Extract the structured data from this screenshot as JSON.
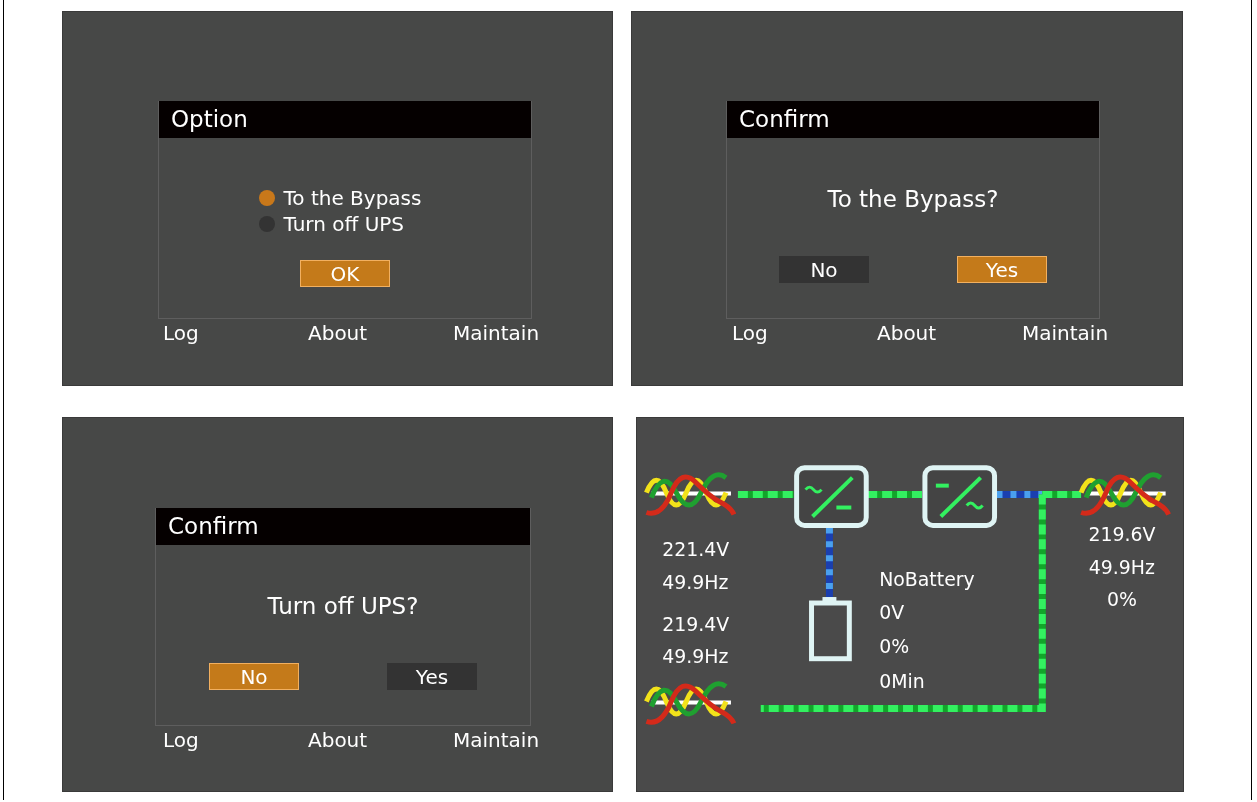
{
  "panels": [
    {
      "kind": "option",
      "dialog": {
        "title": "Option",
        "options": [
          {
            "label": "To the Bypass",
            "selected": true
          },
          {
            "label": "Turn off UPS",
            "selected": false
          }
        ],
        "buttons": [
          {
            "label": "OK",
            "selected": true
          }
        ]
      },
      "menu": [
        "Log",
        "About",
        "Maintain"
      ]
    },
    {
      "kind": "confirm",
      "dialog": {
        "title": "Confirm",
        "message": "To the Bypass?",
        "buttons": [
          {
            "label": "No",
            "selected": false
          },
          {
            "label": "Yes",
            "selected": true
          }
        ]
      },
      "menu": [
        "Log",
        "About",
        "Maintain"
      ]
    },
    {
      "kind": "confirm",
      "dialog": {
        "title": "Confirm",
        "message": "Turn off UPS?",
        "buttons": [
          {
            "label": "No",
            "selected": true
          },
          {
            "label": "Yes",
            "selected": false
          }
        ]
      },
      "menu": [
        "Log",
        "About",
        "Maintain"
      ]
    },
    {
      "kind": "flow",
      "input": {
        "voltage": "221.4V",
        "frequency": "49.9Hz"
      },
      "bypass": {
        "voltage": "219.4V",
        "frequency": "49.9Hz"
      },
      "battery": {
        "status": "NoBattery",
        "voltage": "0V",
        "capacity": "0%",
        "runtime": "0Min"
      },
      "output": {
        "voltage": "219.6V",
        "frequency": "49.9Hz",
        "load": "0%"
      }
    }
  ]
}
